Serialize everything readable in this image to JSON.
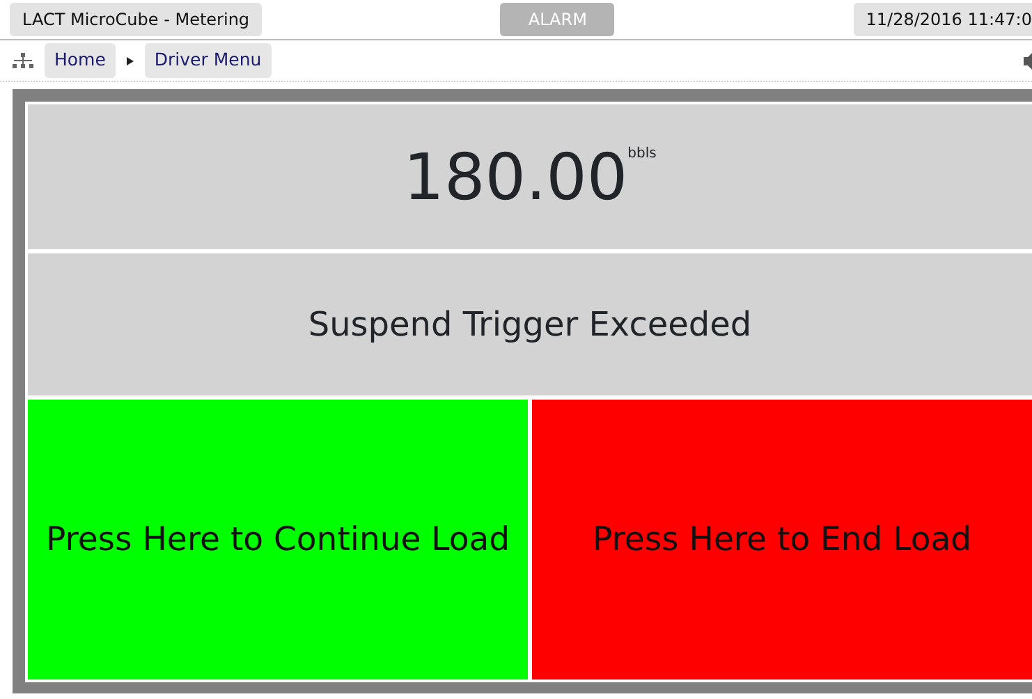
{
  "header": {
    "title": "LACT MicroCube - Metering",
    "alarm": {
      "label": "ALARM",
      "active": false
    },
    "datetime": "11/28/2016 11:47:0"
  },
  "breadcrumb": [
    {
      "label": "Home"
    },
    {
      "label": "Driver Menu"
    }
  ],
  "reading": {
    "value": "180.00",
    "unit": "bbls"
  },
  "message": "Suspend Trigger Exceeded",
  "actions": [
    {
      "label": "Press Here to Continue Load",
      "color": "#00ff00"
    },
    {
      "label": "Press Here to End Load",
      "color": "#ff0000"
    }
  ]
}
